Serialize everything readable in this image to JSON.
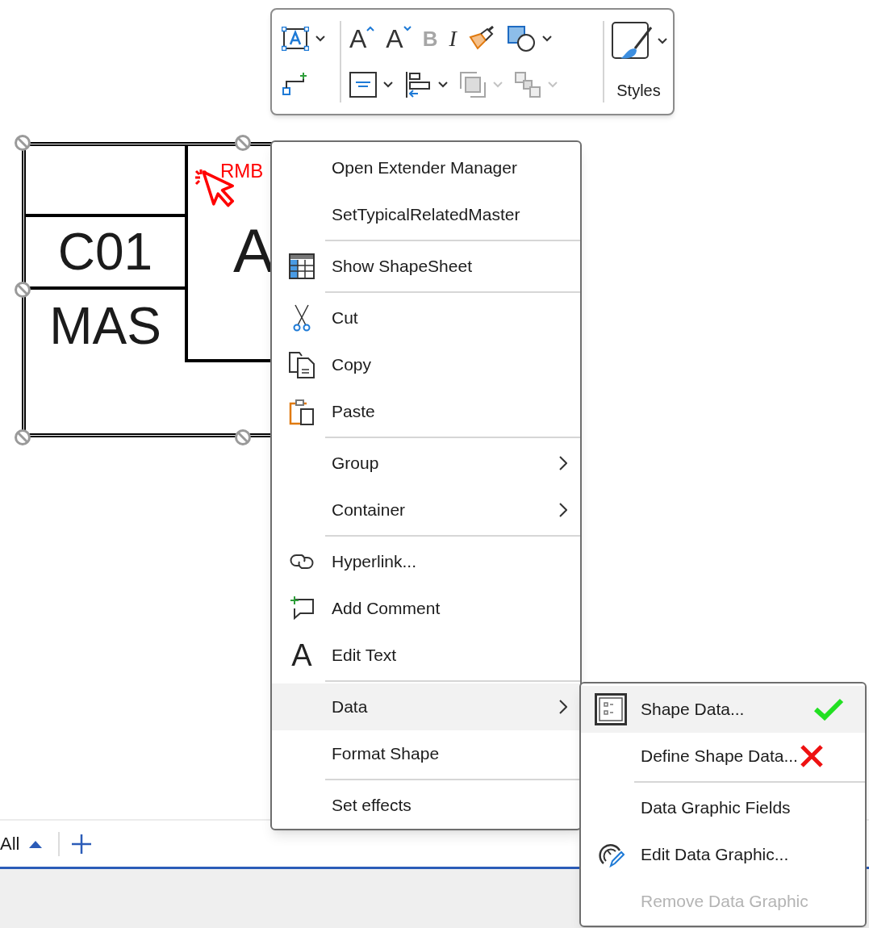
{
  "toolbar": {
    "left_tools": [
      {
        "disabled": false,
        "dropdown": true
      },
      {
        "disabled": false,
        "dropdown": false
      }
    ],
    "format_row": [
      {
        "glyph": "A",
        "disabled": false,
        "dropdown": false
      },
      {
        "glyph": "A",
        "disabled": false,
        "dropdown": false
      },
      {
        "glyph": "B",
        "disabled": true,
        "dropdown": false
      },
      {
        "glyph": "I",
        "disabled": false,
        "dropdown": false
      },
      {
        "disabled": false,
        "dropdown": false
      },
      {
        "disabled": false,
        "dropdown": true
      }
    ],
    "arrange_row": [
      {
        "disabled": false,
        "dropdown": true
      },
      {
        "disabled": false,
        "dropdown": true
      },
      {
        "disabled": true,
        "dropdown": true
      },
      {
        "disabled": true,
        "dropdown": true
      }
    ],
    "styles_button": {
      "label": "Styles"
    }
  },
  "shape": {
    "cells": [
      "C01",
      "MAS"
    ],
    "big_letter": "A",
    "annotation": "RMB"
  },
  "context_menu": {
    "groups": [
      {
        "items": [
          {
            "label": "Open Extender Manager",
            "selected": false,
            "has_submenu": false
          },
          {
            "label": "SetTypicalRelatedMaster",
            "selected": false,
            "has_submenu": false
          }
        ]
      },
      {
        "items": [
          {
            "label": "Show ShapeSheet",
            "selected": false,
            "has_submenu": false
          }
        ]
      },
      {
        "items": [
          {
            "label": "Cut",
            "selected": false,
            "has_submenu": false
          },
          {
            "label": "Copy",
            "selected": false,
            "has_submenu": false
          },
          {
            "label": "Paste",
            "selected": false,
            "has_submenu": false
          }
        ]
      },
      {
        "items": [
          {
            "label": "Group",
            "selected": false,
            "has_submenu": true
          },
          {
            "label": "Container",
            "selected": false,
            "has_submenu": true
          }
        ]
      },
      {
        "items": [
          {
            "label": "Hyperlink...",
            "selected": false,
            "has_submenu": false
          },
          {
            "label": "Add Comment",
            "selected": false,
            "has_submenu": false
          },
          {
            "label": "Edit Text",
            "selected": false,
            "has_submenu": false,
            "glyph": "A"
          }
        ]
      },
      {
        "items": [
          {
            "label": "Data",
            "selected": true,
            "has_submenu": true
          },
          {
            "label": "Format Shape",
            "selected": false,
            "has_submenu": false
          }
        ]
      },
      {
        "items": [
          {
            "label": "Set effects",
            "selected": false,
            "has_submenu": false
          }
        ]
      }
    ]
  },
  "data_submenu": {
    "groups": [
      {
        "items": [
          {
            "label": "Shape Data...",
            "selected": true,
            "disabled": false,
            "check_mark": true,
            "cross_mark": false
          },
          {
            "label": "Define Shape Data...",
            "selected": false,
            "disabled": false,
            "check_mark": false,
            "cross_mark": true
          }
        ]
      },
      {
        "items": [
          {
            "label": "Data Graphic Fields",
            "selected": false,
            "disabled": false,
            "check_mark": false,
            "cross_mark": false
          },
          {
            "label": "Edit Data Graphic...",
            "selected": false,
            "disabled": false,
            "check_mark": false,
            "cross_mark": false
          },
          {
            "label": "Remove Data Graphic",
            "selected": false,
            "disabled": true,
            "check_mark": false,
            "cross_mark": false
          }
        ]
      }
    ]
  },
  "page_tabs": {
    "all_label": "All"
  }
}
